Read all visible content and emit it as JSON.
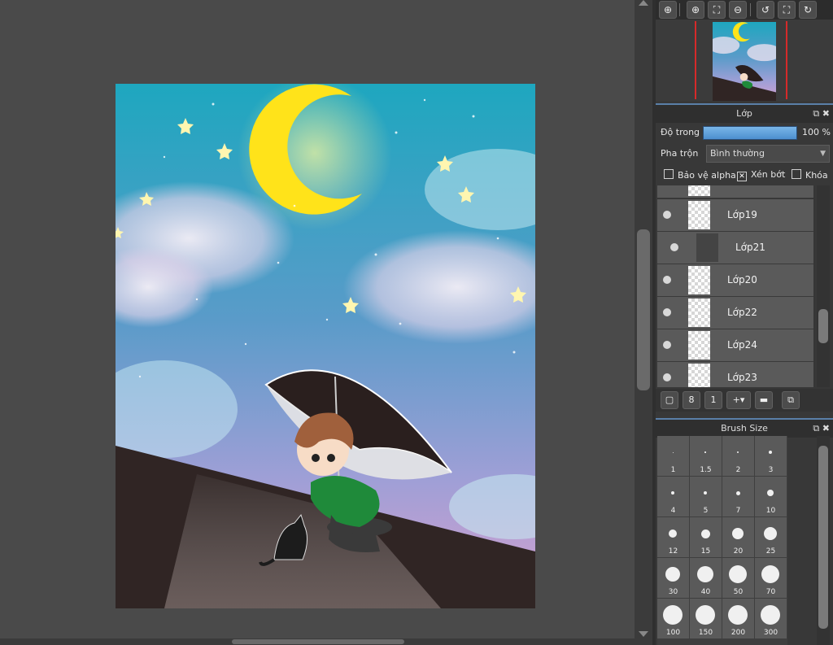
{
  "navigator": {
    "tools": [
      "zoom-fit-icon",
      "zoom-in-icon",
      "fit-window-icon",
      "zoom-out-icon",
      "rotate-left-icon",
      "fullscreen-icon",
      "rotate-right-icon"
    ]
  },
  "layer_panel": {
    "title": "Lớp",
    "opacity_label": "Độ trong",
    "opacity_value": "100 %",
    "opacity_fraction": 1.0,
    "blend_label": "Pha trộn",
    "blend_value": "Bình thường",
    "checkbox_alpha": "Bảo vệ alpha",
    "checkbox_clip": "Xén bớt",
    "checkbox_clip_checked": true,
    "checkbox_lock": "Khóa",
    "layers": [
      {
        "name": ""
      },
      {
        "name": "Lớp19"
      },
      {
        "name": "Lớp21"
      },
      {
        "name": "Lớp20"
      },
      {
        "name": "Lớp22"
      },
      {
        "name": "Lớp24"
      },
      {
        "name": "Lớp23"
      }
    ]
  },
  "brush_panel": {
    "title": "Brush Size",
    "sizes": [
      "1",
      "1.5",
      "2",
      "3",
      "4",
      "5",
      "7",
      "10",
      "12",
      "15",
      "20",
      "25",
      "30",
      "40",
      "50",
      "70",
      "100",
      "150",
      "200",
      "300"
    ]
  },
  "colors": {
    "accent": "#5a7fa8",
    "moon": "#ffe31a",
    "sky_top": "#1ea7bf",
    "sky_bottom": "#c79ccf",
    "roof": "#302524"
  }
}
